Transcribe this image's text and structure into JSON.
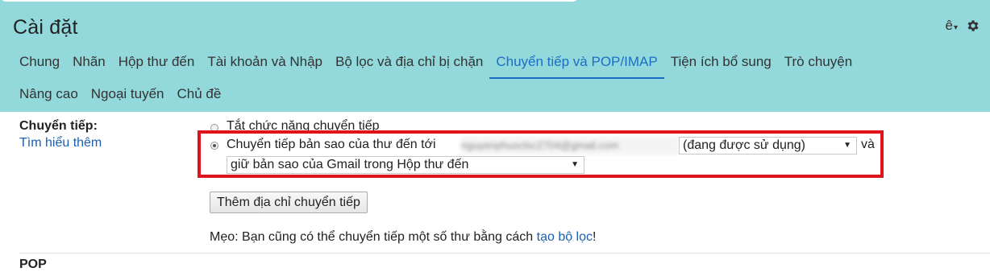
{
  "page": {
    "title": "Cài đặt"
  },
  "header": {
    "language_label": "ê",
    "caret": "▾"
  },
  "tabs": {
    "row1": [
      {
        "label": "Chung"
      },
      {
        "label": "Nhãn"
      },
      {
        "label": "Hộp thư đến"
      },
      {
        "label": "Tài khoản và Nhập"
      },
      {
        "label": "Bộ lọc và địa chỉ bị chặn"
      },
      {
        "label": "Chuyển tiếp và POP/IMAP",
        "active": true
      },
      {
        "label": "Tiện ích bổ sung"
      },
      {
        "label": "Trò chuyện"
      }
    ],
    "row2": [
      {
        "label": "Nâng cao"
      },
      {
        "label": "Ngoại tuyến"
      },
      {
        "label": "Chủ đề"
      }
    ]
  },
  "forwarding": {
    "section_label": "Chuyển tiếp:",
    "learn_more": "Tìm hiểu thêm",
    "option_disable": "Tắt chức năng chuyển tiếp",
    "option_forward": "Chuyển tiếp bản sao của thư đến tới",
    "forward_address": "nguyenphuoclsc2704@gmail.com",
    "status_select": "(đang được sử dụng)",
    "and_text": "và",
    "keep_select": "giữ bản sao của Gmail trong Hộp thư đến",
    "selected_option": "forward",
    "add_button": "Thêm địa chỉ chuyển tiếp",
    "tip_prefix": "Mẹo: Bạn cũng có thể chuyển tiếp một số thư bằng cách ",
    "tip_link": "tạo bộ lọc",
    "tip_suffix": "!"
  },
  "next_section_peek": "POP",
  "colors": {
    "header_bg": "#93d8da",
    "active_tab": "#1a6fc4",
    "link": "#1a5fb0",
    "highlight": "#e0121b"
  },
  "icons": {
    "settings": "gear-icon",
    "dropdown": "chevron-down-icon"
  }
}
